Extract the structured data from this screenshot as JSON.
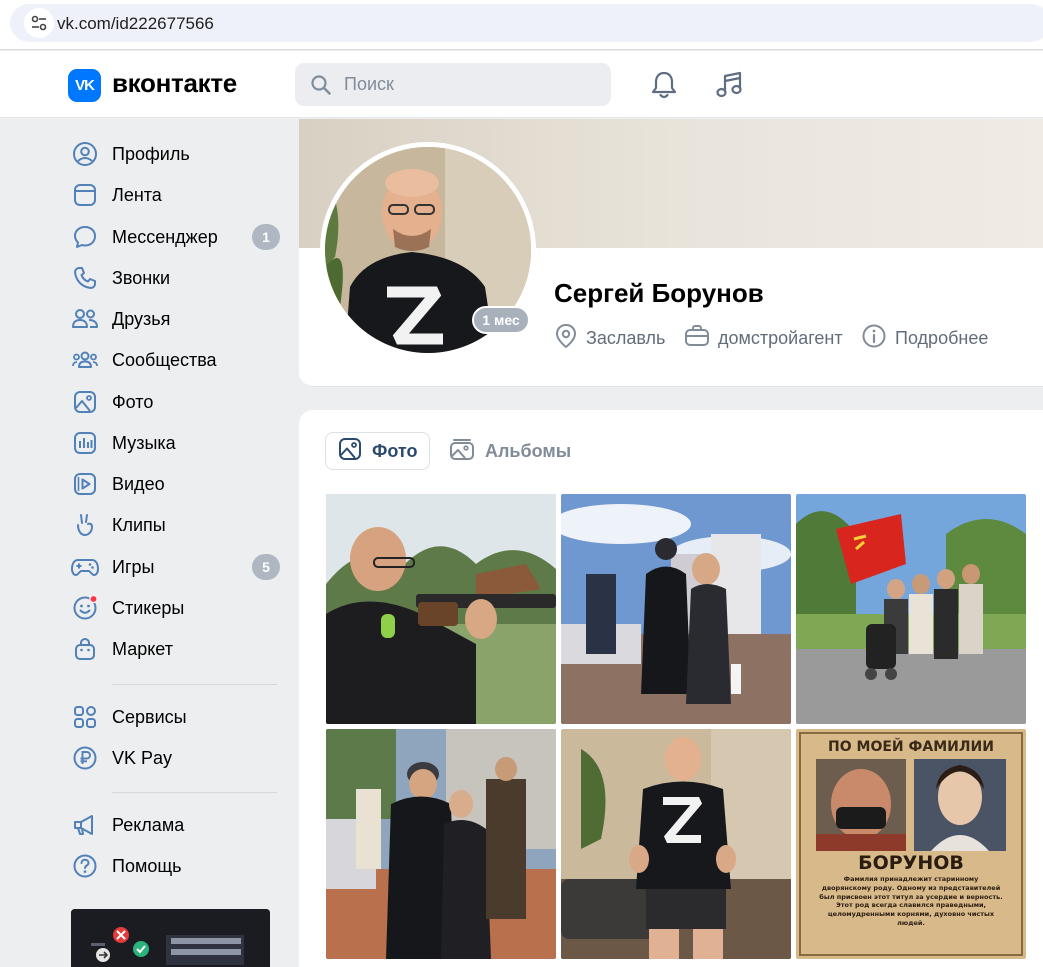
{
  "browser": {
    "url": "vk.com/id222677566"
  },
  "header": {
    "logo_mark": "VK",
    "logo_text": "вконтакте",
    "search_placeholder": "Поиск"
  },
  "sidebar": {
    "items": [
      {
        "label": "Профиль",
        "icon": "user-circle-icon"
      },
      {
        "label": "Лента",
        "icon": "newsfeed-icon"
      },
      {
        "label": "Мессенджер",
        "icon": "message-icon",
        "badge": "1"
      },
      {
        "label": "Звонки",
        "icon": "phone-icon"
      },
      {
        "label": "Друзья",
        "icon": "friends-icon"
      },
      {
        "label": "Сообщества",
        "icon": "groups-icon"
      },
      {
        "label": "Фото",
        "icon": "photo-icon"
      },
      {
        "label": "Музыка",
        "icon": "music-icon"
      },
      {
        "label": "Видео",
        "icon": "video-icon"
      },
      {
        "label": "Клипы",
        "icon": "clips-icon"
      },
      {
        "label": "Игры",
        "icon": "gamepad-icon",
        "badge": "5"
      },
      {
        "label": "Стикеры",
        "icon": "sticker-icon"
      },
      {
        "label": "Маркет",
        "icon": "market-icon"
      }
    ],
    "secondary": [
      {
        "label": "Сервисы",
        "icon": "services-icon"
      },
      {
        "label": "VK Pay",
        "icon": "vkpay-icon"
      }
    ],
    "tertiary": [
      {
        "label": "Реклама",
        "icon": "megaphone-icon"
      },
      {
        "label": "Помощь",
        "icon": "help-icon"
      }
    ]
  },
  "profile": {
    "name": "Сергей Борунов",
    "avatar_badge": "1 мес",
    "city": "Заславль",
    "work": "домстройагент",
    "more": "Подробнее"
  },
  "photos": {
    "tabs": [
      {
        "label": "Фото",
        "active": true
      },
      {
        "label": "Альбомы",
        "active": false
      }
    ],
    "poster": {
      "heading": "ПО МОЕЙ ФАМИЛИИ",
      "surname": "БОРУНОВ",
      "text": "Фамилия принадлежит старинному дворянскому роду. Одному из представителей был присвоен этот титул за усердие и верность. Этот род всегда славился праведными, целомудренными корнями, духовно чистых людей."
    }
  },
  "colors": {
    "accent": "#0077ff",
    "badge": "#aeb7c2",
    "secondary_text": "#626d7a",
    "page_bg": "#edeef0",
    "notification_dot": "#ff3347"
  }
}
